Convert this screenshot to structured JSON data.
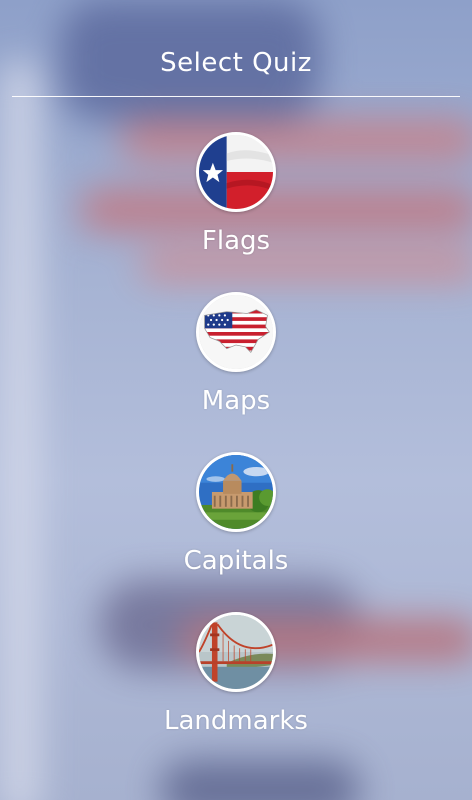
{
  "header": {
    "title": "Select Quiz"
  },
  "quizzes": [
    {
      "label": "Flags",
      "icon": "texas-flag-icon"
    },
    {
      "label": "Maps",
      "icon": "usa-map-icon"
    },
    {
      "label": "Capitals",
      "icon": "capitol-building-icon"
    },
    {
      "label": "Landmarks",
      "icon": "golden-gate-bridge-icon"
    }
  ],
  "colors": {
    "text": "#ffffff",
    "background_blue": "#8ea0c9",
    "background_red": "#b86a72"
  }
}
